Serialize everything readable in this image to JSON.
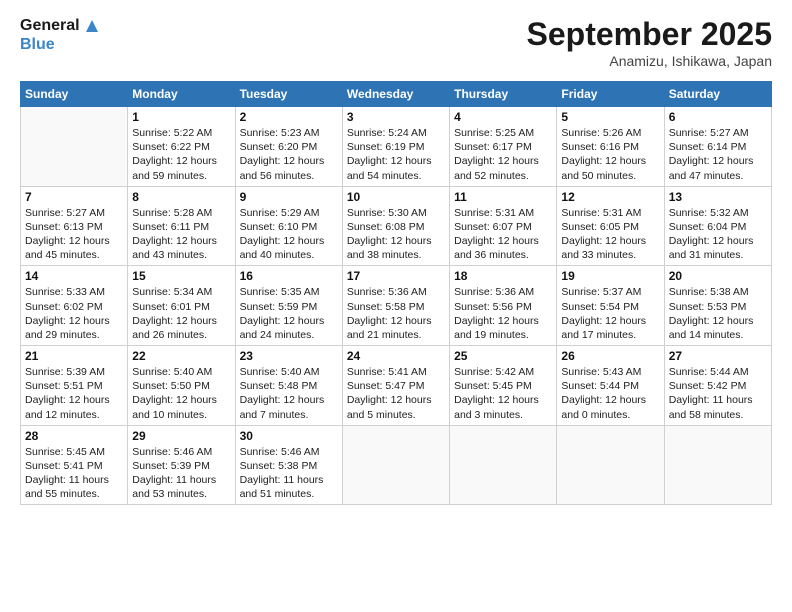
{
  "header": {
    "logo_line1": "General",
    "logo_line2": "Blue",
    "month": "September 2025",
    "location": "Anamizu, Ishikawa, Japan"
  },
  "days_of_week": [
    "Sunday",
    "Monday",
    "Tuesday",
    "Wednesday",
    "Thursday",
    "Friday",
    "Saturday"
  ],
  "weeks": [
    [
      {
        "day": "",
        "info": ""
      },
      {
        "day": "1",
        "info": "Sunrise: 5:22 AM\nSunset: 6:22 PM\nDaylight: 12 hours\nand 59 minutes."
      },
      {
        "day": "2",
        "info": "Sunrise: 5:23 AM\nSunset: 6:20 PM\nDaylight: 12 hours\nand 56 minutes."
      },
      {
        "day": "3",
        "info": "Sunrise: 5:24 AM\nSunset: 6:19 PM\nDaylight: 12 hours\nand 54 minutes."
      },
      {
        "day": "4",
        "info": "Sunrise: 5:25 AM\nSunset: 6:17 PM\nDaylight: 12 hours\nand 52 minutes."
      },
      {
        "day": "5",
        "info": "Sunrise: 5:26 AM\nSunset: 6:16 PM\nDaylight: 12 hours\nand 50 minutes."
      },
      {
        "day": "6",
        "info": "Sunrise: 5:27 AM\nSunset: 6:14 PM\nDaylight: 12 hours\nand 47 minutes."
      }
    ],
    [
      {
        "day": "7",
        "info": "Sunrise: 5:27 AM\nSunset: 6:13 PM\nDaylight: 12 hours\nand 45 minutes."
      },
      {
        "day": "8",
        "info": "Sunrise: 5:28 AM\nSunset: 6:11 PM\nDaylight: 12 hours\nand 43 minutes."
      },
      {
        "day": "9",
        "info": "Sunrise: 5:29 AM\nSunset: 6:10 PM\nDaylight: 12 hours\nand 40 minutes."
      },
      {
        "day": "10",
        "info": "Sunrise: 5:30 AM\nSunset: 6:08 PM\nDaylight: 12 hours\nand 38 minutes."
      },
      {
        "day": "11",
        "info": "Sunrise: 5:31 AM\nSunset: 6:07 PM\nDaylight: 12 hours\nand 36 minutes."
      },
      {
        "day": "12",
        "info": "Sunrise: 5:31 AM\nSunset: 6:05 PM\nDaylight: 12 hours\nand 33 minutes."
      },
      {
        "day": "13",
        "info": "Sunrise: 5:32 AM\nSunset: 6:04 PM\nDaylight: 12 hours\nand 31 minutes."
      }
    ],
    [
      {
        "day": "14",
        "info": "Sunrise: 5:33 AM\nSunset: 6:02 PM\nDaylight: 12 hours\nand 29 minutes."
      },
      {
        "day": "15",
        "info": "Sunrise: 5:34 AM\nSunset: 6:01 PM\nDaylight: 12 hours\nand 26 minutes."
      },
      {
        "day": "16",
        "info": "Sunrise: 5:35 AM\nSunset: 5:59 PM\nDaylight: 12 hours\nand 24 minutes."
      },
      {
        "day": "17",
        "info": "Sunrise: 5:36 AM\nSunset: 5:58 PM\nDaylight: 12 hours\nand 21 minutes."
      },
      {
        "day": "18",
        "info": "Sunrise: 5:36 AM\nSunset: 5:56 PM\nDaylight: 12 hours\nand 19 minutes."
      },
      {
        "day": "19",
        "info": "Sunrise: 5:37 AM\nSunset: 5:54 PM\nDaylight: 12 hours\nand 17 minutes."
      },
      {
        "day": "20",
        "info": "Sunrise: 5:38 AM\nSunset: 5:53 PM\nDaylight: 12 hours\nand 14 minutes."
      }
    ],
    [
      {
        "day": "21",
        "info": "Sunrise: 5:39 AM\nSunset: 5:51 PM\nDaylight: 12 hours\nand 12 minutes."
      },
      {
        "day": "22",
        "info": "Sunrise: 5:40 AM\nSunset: 5:50 PM\nDaylight: 12 hours\nand 10 minutes."
      },
      {
        "day": "23",
        "info": "Sunrise: 5:40 AM\nSunset: 5:48 PM\nDaylight: 12 hours\nand 7 minutes."
      },
      {
        "day": "24",
        "info": "Sunrise: 5:41 AM\nSunset: 5:47 PM\nDaylight: 12 hours\nand 5 minutes."
      },
      {
        "day": "25",
        "info": "Sunrise: 5:42 AM\nSunset: 5:45 PM\nDaylight: 12 hours\nand 3 minutes."
      },
      {
        "day": "26",
        "info": "Sunrise: 5:43 AM\nSunset: 5:44 PM\nDaylight: 12 hours\nand 0 minutes."
      },
      {
        "day": "27",
        "info": "Sunrise: 5:44 AM\nSunset: 5:42 PM\nDaylight: 11 hours\nand 58 minutes."
      }
    ],
    [
      {
        "day": "28",
        "info": "Sunrise: 5:45 AM\nSunset: 5:41 PM\nDaylight: 11 hours\nand 55 minutes."
      },
      {
        "day": "29",
        "info": "Sunrise: 5:46 AM\nSunset: 5:39 PM\nDaylight: 11 hours\nand 53 minutes."
      },
      {
        "day": "30",
        "info": "Sunrise: 5:46 AM\nSunset: 5:38 PM\nDaylight: 11 hours\nand 51 minutes."
      },
      {
        "day": "",
        "info": ""
      },
      {
        "day": "",
        "info": ""
      },
      {
        "day": "",
        "info": ""
      },
      {
        "day": "",
        "info": ""
      }
    ]
  ]
}
